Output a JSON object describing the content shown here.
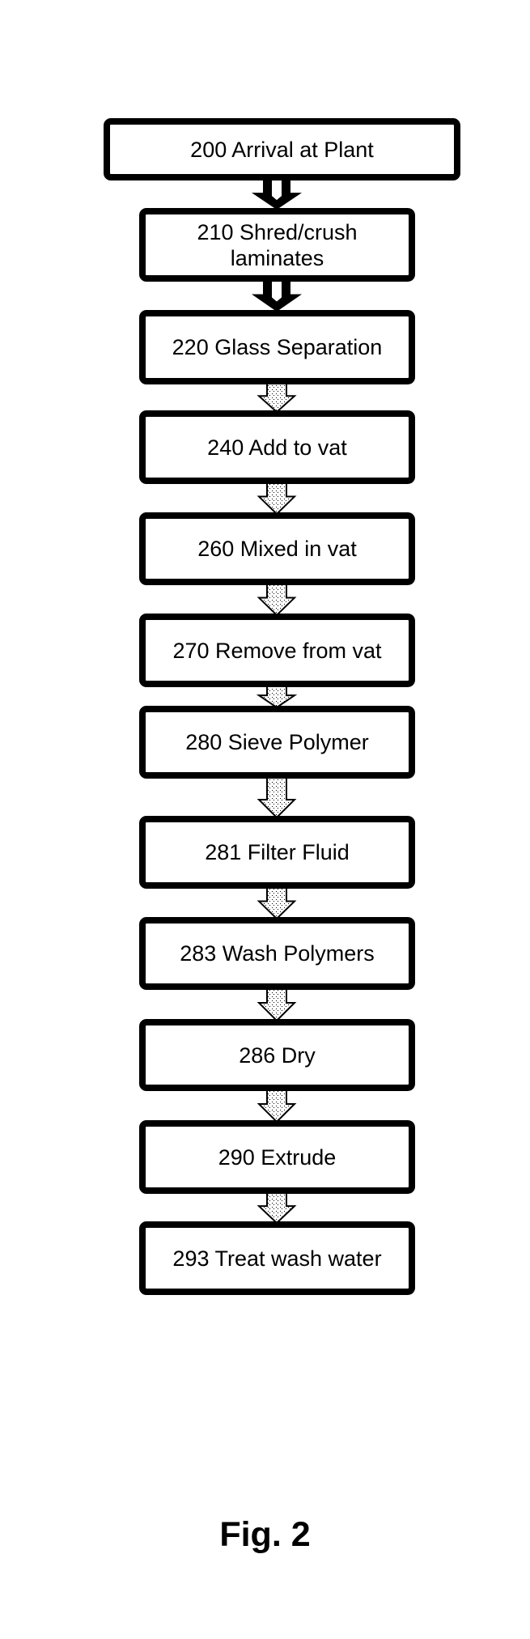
{
  "figure": {
    "caption": "Fig. 2",
    "colors": {
      "stroke": "#000000",
      "fill": "#ffffff",
      "stipple": "#000000"
    }
  },
  "steps": [
    {
      "id": "200",
      "label": "200 Arrival at Plant"
    },
    {
      "id": "210",
      "label": "210 Shred/crush laminates"
    },
    {
      "id": "220",
      "label": "220 Glass Separation"
    },
    {
      "id": "240",
      "label": "240 Add to vat"
    },
    {
      "id": "260",
      "label": "260 Mixed in vat"
    },
    {
      "id": "270",
      "label": "270 Remove from vat"
    },
    {
      "id": "280",
      "label": "280 Sieve Polymer"
    },
    {
      "id": "281",
      "label": "281 Filter Fluid"
    },
    {
      "id": "283",
      "label": "283 Wash Polymers"
    },
    {
      "id": "286",
      "label": "286 Dry"
    },
    {
      "id": "290",
      "label": "290 Extrude"
    },
    {
      "id": "293",
      "label": "293 Treat wash water"
    }
  ],
  "connectors": [
    {
      "from": "200",
      "to": "210",
      "style": "solid"
    },
    {
      "from": "210",
      "to": "220",
      "style": "solid"
    },
    {
      "from": "220",
      "to": "240",
      "style": "stippled"
    },
    {
      "from": "240",
      "to": "260",
      "style": "stippled"
    },
    {
      "from": "260",
      "to": "270",
      "style": "stippled"
    },
    {
      "from": "270",
      "to": "280",
      "style": "stippled"
    },
    {
      "from": "280",
      "to": "281",
      "style": "stippled"
    },
    {
      "from": "281",
      "to": "283",
      "style": "stippled"
    },
    {
      "from": "283",
      "to": "286",
      "style": "stippled"
    },
    {
      "from": "286",
      "to": "290",
      "style": "stippled"
    },
    {
      "from": "290",
      "to": "293",
      "style": "stippled"
    }
  ]
}
